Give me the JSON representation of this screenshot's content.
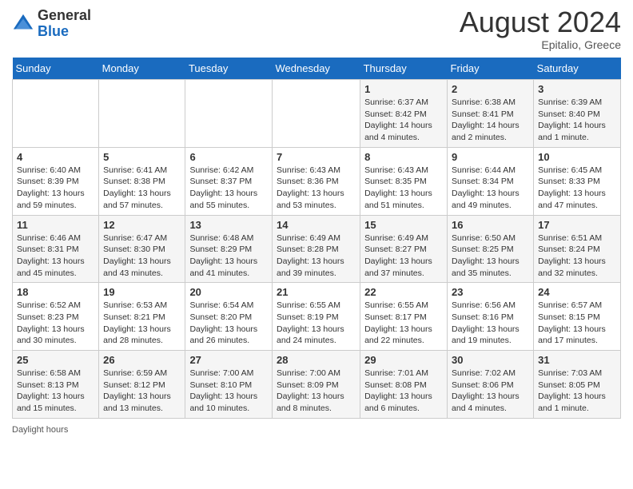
{
  "logo": {
    "text_general": "General",
    "text_blue": "Blue"
  },
  "title": {
    "month_year": "August 2024",
    "location": "Epitalio, Greece"
  },
  "days_of_week": [
    "Sunday",
    "Monday",
    "Tuesday",
    "Wednesday",
    "Thursday",
    "Friday",
    "Saturday"
  ],
  "footer": {
    "daylight_label": "Daylight hours"
  },
  "weeks": [
    [
      {
        "day": "",
        "info": ""
      },
      {
        "day": "",
        "info": ""
      },
      {
        "day": "",
        "info": ""
      },
      {
        "day": "",
        "info": ""
      },
      {
        "day": "1",
        "info": "Sunrise: 6:37 AM\nSunset: 8:42 PM\nDaylight: 14 hours\nand 4 minutes."
      },
      {
        "day": "2",
        "info": "Sunrise: 6:38 AM\nSunset: 8:41 PM\nDaylight: 14 hours\nand 2 minutes."
      },
      {
        "day": "3",
        "info": "Sunrise: 6:39 AM\nSunset: 8:40 PM\nDaylight: 14 hours\nand 1 minute."
      }
    ],
    [
      {
        "day": "4",
        "info": "Sunrise: 6:40 AM\nSunset: 8:39 PM\nDaylight: 13 hours\nand 59 minutes."
      },
      {
        "day": "5",
        "info": "Sunrise: 6:41 AM\nSunset: 8:38 PM\nDaylight: 13 hours\nand 57 minutes."
      },
      {
        "day": "6",
        "info": "Sunrise: 6:42 AM\nSunset: 8:37 PM\nDaylight: 13 hours\nand 55 minutes."
      },
      {
        "day": "7",
        "info": "Sunrise: 6:43 AM\nSunset: 8:36 PM\nDaylight: 13 hours\nand 53 minutes."
      },
      {
        "day": "8",
        "info": "Sunrise: 6:43 AM\nSunset: 8:35 PM\nDaylight: 13 hours\nand 51 minutes."
      },
      {
        "day": "9",
        "info": "Sunrise: 6:44 AM\nSunset: 8:34 PM\nDaylight: 13 hours\nand 49 minutes."
      },
      {
        "day": "10",
        "info": "Sunrise: 6:45 AM\nSunset: 8:33 PM\nDaylight: 13 hours\nand 47 minutes."
      }
    ],
    [
      {
        "day": "11",
        "info": "Sunrise: 6:46 AM\nSunset: 8:31 PM\nDaylight: 13 hours\nand 45 minutes."
      },
      {
        "day": "12",
        "info": "Sunrise: 6:47 AM\nSunset: 8:30 PM\nDaylight: 13 hours\nand 43 minutes."
      },
      {
        "day": "13",
        "info": "Sunrise: 6:48 AM\nSunset: 8:29 PM\nDaylight: 13 hours\nand 41 minutes."
      },
      {
        "day": "14",
        "info": "Sunrise: 6:49 AM\nSunset: 8:28 PM\nDaylight: 13 hours\nand 39 minutes."
      },
      {
        "day": "15",
        "info": "Sunrise: 6:49 AM\nSunset: 8:27 PM\nDaylight: 13 hours\nand 37 minutes."
      },
      {
        "day": "16",
        "info": "Sunrise: 6:50 AM\nSunset: 8:25 PM\nDaylight: 13 hours\nand 35 minutes."
      },
      {
        "day": "17",
        "info": "Sunrise: 6:51 AM\nSunset: 8:24 PM\nDaylight: 13 hours\nand 32 minutes."
      }
    ],
    [
      {
        "day": "18",
        "info": "Sunrise: 6:52 AM\nSunset: 8:23 PM\nDaylight: 13 hours\nand 30 minutes."
      },
      {
        "day": "19",
        "info": "Sunrise: 6:53 AM\nSunset: 8:21 PM\nDaylight: 13 hours\nand 28 minutes."
      },
      {
        "day": "20",
        "info": "Sunrise: 6:54 AM\nSunset: 8:20 PM\nDaylight: 13 hours\nand 26 minutes."
      },
      {
        "day": "21",
        "info": "Sunrise: 6:55 AM\nSunset: 8:19 PM\nDaylight: 13 hours\nand 24 minutes."
      },
      {
        "day": "22",
        "info": "Sunrise: 6:55 AM\nSunset: 8:17 PM\nDaylight: 13 hours\nand 22 minutes."
      },
      {
        "day": "23",
        "info": "Sunrise: 6:56 AM\nSunset: 8:16 PM\nDaylight: 13 hours\nand 19 minutes."
      },
      {
        "day": "24",
        "info": "Sunrise: 6:57 AM\nSunset: 8:15 PM\nDaylight: 13 hours\nand 17 minutes."
      }
    ],
    [
      {
        "day": "25",
        "info": "Sunrise: 6:58 AM\nSunset: 8:13 PM\nDaylight: 13 hours\nand 15 minutes."
      },
      {
        "day": "26",
        "info": "Sunrise: 6:59 AM\nSunset: 8:12 PM\nDaylight: 13 hours\nand 13 minutes."
      },
      {
        "day": "27",
        "info": "Sunrise: 7:00 AM\nSunset: 8:10 PM\nDaylight: 13 hours\nand 10 minutes."
      },
      {
        "day": "28",
        "info": "Sunrise: 7:00 AM\nSunset: 8:09 PM\nDaylight: 13 hours\nand 8 minutes."
      },
      {
        "day": "29",
        "info": "Sunrise: 7:01 AM\nSunset: 8:08 PM\nDaylight: 13 hours\nand 6 minutes."
      },
      {
        "day": "30",
        "info": "Sunrise: 7:02 AM\nSunset: 8:06 PM\nDaylight: 13 hours\nand 4 minutes."
      },
      {
        "day": "31",
        "info": "Sunrise: 7:03 AM\nSunset: 8:05 PM\nDaylight: 13 hours\nand 1 minute."
      }
    ]
  ]
}
